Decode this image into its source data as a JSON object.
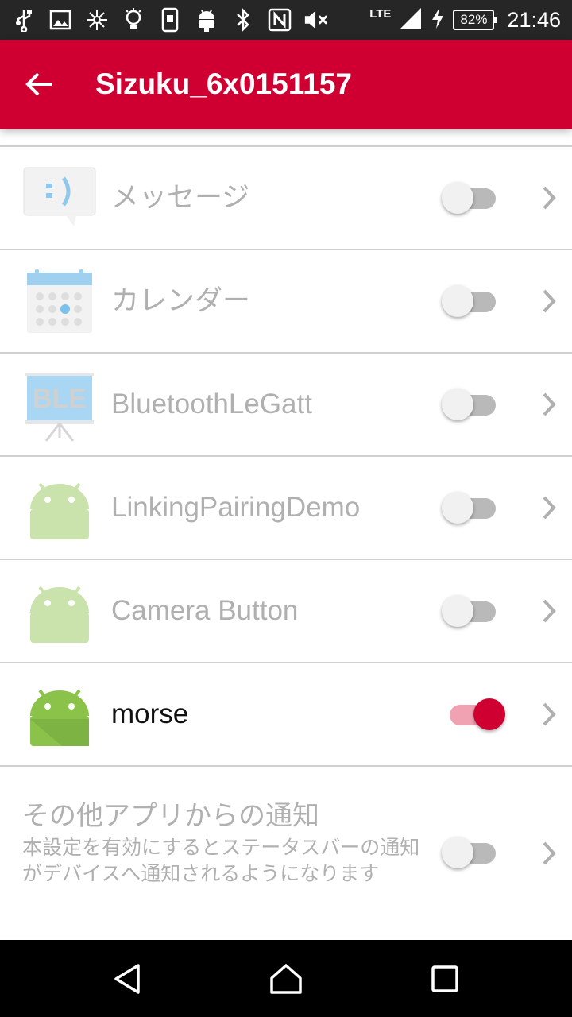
{
  "status_bar": {
    "icons": [
      "usb-icon",
      "image-icon",
      "network-hub-icon",
      "lightbulb-icon",
      "phone-icon",
      "android-icon",
      "bluetooth-icon",
      "nfc-icon",
      "mute-icon"
    ],
    "network": "LTE",
    "battery": "82%",
    "time": "21:46"
  },
  "appbar": {
    "title": "Sizuku_6x0151157",
    "back_icon": "arrow-back-icon"
  },
  "apps": [
    {
      "label": "メッセージ",
      "icon": "message-icon",
      "enabled": false
    },
    {
      "label": "カレンダー",
      "icon": "calendar-icon",
      "enabled": false
    },
    {
      "label": "BluetoothLeGatt",
      "icon": "ble-icon",
      "icon_text": "BLE",
      "enabled": false
    },
    {
      "label": "LinkingPairingDemo",
      "icon": "android-icon",
      "enabled": false
    },
    {
      "label": "Camera Button",
      "icon": "android-icon",
      "enabled": false
    },
    {
      "label": "morse",
      "icon": "android-icon",
      "enabled": true
    }
  ],
  "other": {
    "title": "その他アプリからの通知",
    "description": "本設定を有効にするとステータスバーの通知がデバイスへ通知されるようになります",
    "enabled": false
  },
  "navbar": {
    "buttons": [
      "back-nav-icon",
      "home-nav-icon",
      "recents-nav-icon"
    ]
  },
  "colors": {
    "accent": "#cf0031",
    "status_bar": "#262626",
    "disabled_text": "#b0b0b0"
  }
}
